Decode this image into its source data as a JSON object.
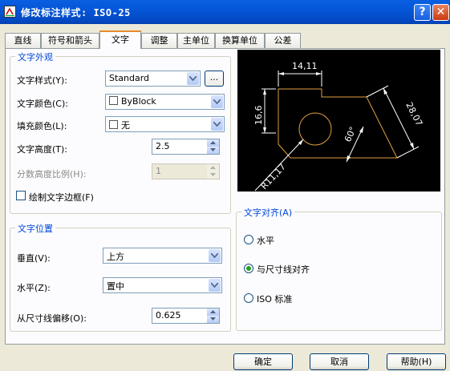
{
  "window": {
    "title": "修改标注样式: ISO-25",
    "help_glyph": "?",
    "close_glyph": "✕"
  },
  "tabs": [
    {
      "label": "直线"
    },
    {
      "label": "符号和箭头"
    },
    {
      "label": "文字"
    },
    {
      "label": "调整"
    },
    {
      "label": "主单位"
    },
    {
      "label": "换算单位"
    },
    {
      "label": "公差"
    }
  ],
  "text_appearance": {
    "group_label": "文字外观",
    "style_label": "文字样式(Y):",
    "style_value": "Standard",
    "style_browse": "...",
    "color_label": "文字颜色(C):",
    "color_value": "ByBlock",
    "fill_label": "填充颜色(L):",
    "fill_value": "无",
    "height_label": "文字高度(T):",
    "height_value": "2.5",
    "fraction_label": "分数高度比例(H):",
    "fraction_value": "1",
    "frame_label": "绘制文字边框(F)"
  },
  "text_placement": {
    "group_label": "文字位置",
    "vertical_label": "垂直(V):",
    "vertical_value": "上方",
    "horizontal_label": "水平(Z):",
    "horizontal_value": "置中",
    "offset_label": "从尺寸线偏移(O):",
    "offset_value": "0.625"
  },
  "text_alignment": {
    "group_label": "文字对齐(A)",
    "options": [
      {
        "label": "水平",
        "selected": false
      },
      {
        "label": "与尺寸线对齐",
        "selected": true
      },
      {
        "label": "ISO 标准",
        "selected": false
      }
    ]
  },
  "preview": {
    "dim_top": "14,11",
    "dim_left": "16,6",
    "dim_right": "28,07",
    "dim_angle": "60°",
    "dim_radius": "R11,17",
    "colors": {
      "background": "#000000",
      "lines": "#ffffff",
      "geometry": "#e0a040"
    }
  },
  "buttons": {
    "ok": "确定",
    "cancel": "取消",
    "help": "帮助(H)"
  }
}
